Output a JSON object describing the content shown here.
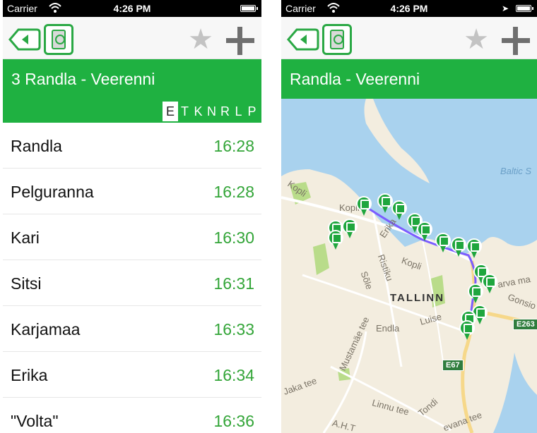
{
  "status_bar": {
    "carrier": "Carrier",
    "time": "4:26 PM"
  },
  "colors": {
    "accent_green": "#1fb141",
    "time_green": "#33a538",
    "sea": "#a9d2ee",
    "land": "#f3eddf",
    "route": "#7b5cff"
  },
  "icons": {
    "back": "back-arrow-icon",
    "card": "ticket-card-icon",
    "favorite": "star-icon",
    "add": "plus-icon",
    "wifi": "wifi-icon",
    "battery": "battery-icon",
    "location": "location-arrow-icon",
    "bus_stop": "bus-stop-pin-icon"
  },
  "schedule": {
    "route_title": "3 Randla - Veerenni",
    "day_tabs": [
      "E",
      "T",
      "K",
      "N",
      "R",
      "L",
      "P"
    ],
    "active_day": "E",
    "stops": [
      {
        "name": "Randla",
        "time": "16:28"
      },
      {
        "name": "Pelguranna",
        "time": "16:28"
      },
      {
        "name": "Kari",
        "time": "16:30"
      },
      {
        "name": "Sitsi",
        "time": "16:31"
      },
      {
        "name": "Karjamaa",
        "time": "16:33"
      },
      {
        "name": "Erika",
        "time": "16:34"
      },
      {
        "name": "\"Volta\"",
        "time": "16:36"
      }
    ]
  },
  "map_screen": {
    "route_title": "Randla - Veerenni",
    "labels": {
      "sea": "Baltic S",
      "city": "TALLINN",
      "kopli1": "Kopli",
      "kopli2": "Kopli",
      "kopli3": "Kopli",
      "erika": "Erika",
      "ristiku": "Ristiku",
      "sole": "Sõle",
      "endla": "Endla",
      "luise": "Luise",
      "mustamae": "Mustamäe tee",
      "paldiski": "Jaka tee",
      "linnu": "Linnu tee",
      "tondi": "Tondi",
      "gonsi": "Gonsio",
      "narva": "arva ma",
      "ahtee": "A.H.T",
      "jaama": "evana tee",
      "e263": "E263",
      "e67": "E67"
    }
  }
}
